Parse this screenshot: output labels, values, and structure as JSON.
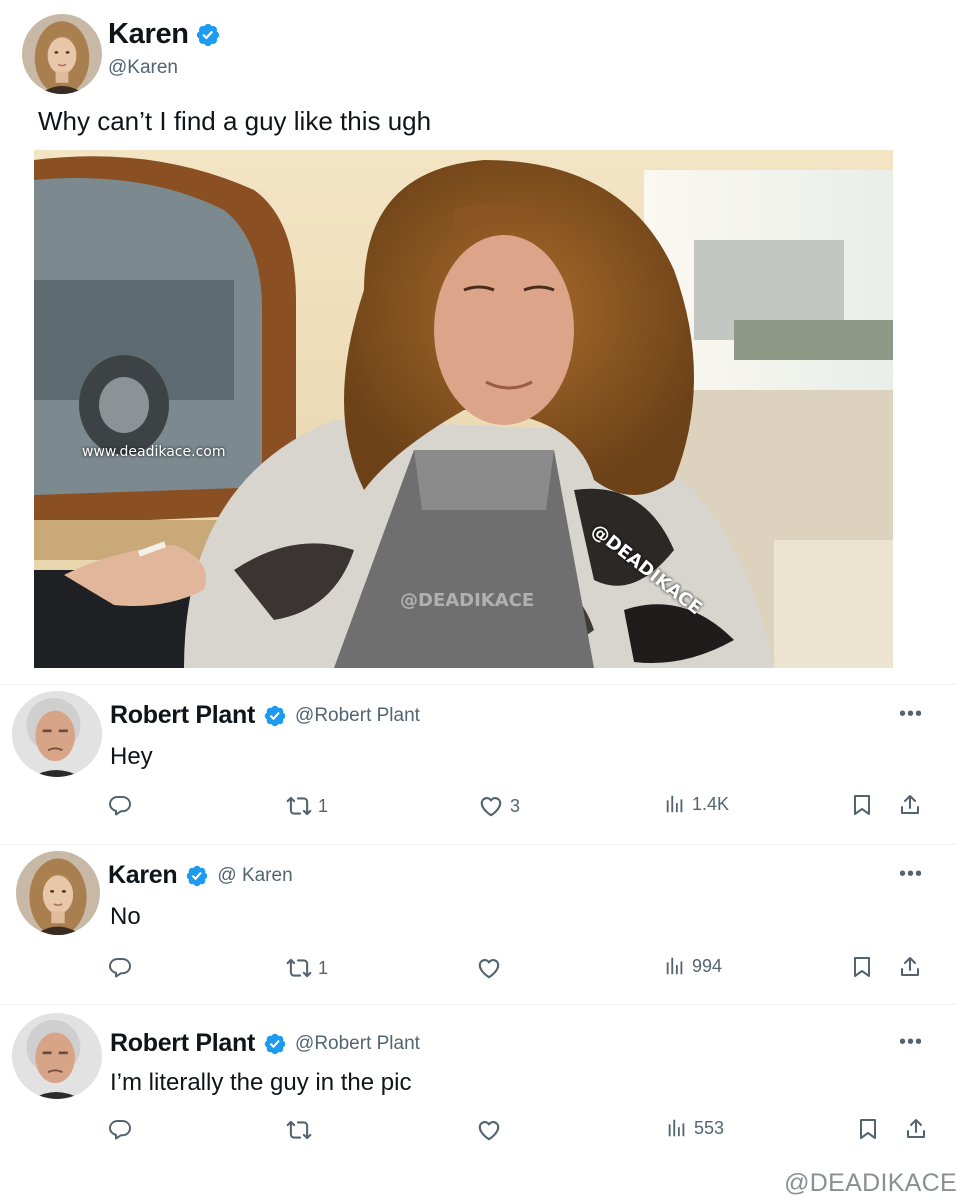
{
  "post": {
    "author_name": "Karen",
    "author_handle": "@Karen",
    "verified": true,
    "text": "Why can’t I find a guy like this ugh",
    "photo_watermarks": {
      "site": "www.deadikace.com",
      "handle": "@DEADIKACE",
      "faint": "@DEADIKACE"
    }
  },
  "replies": [
    {
      "author_name": "Robert Plant",
      "author_handle": "@Robert Plant",
      "verified": true,
      "text": "Hey",
      "more": "•••",
      "reposts": "1",
      "likes": "3",
      "views": "1.4K"
    },
    {
      "author_name": "Karen",
      "author_handle": "@ Karen",
      "verified": true,
      "text": "No",
      "more": "•••",
      "reposts": "1",
      "likes": "",
      "views": "994"
    },
    {
      "author_name": "Robert Plant",
      "author_handle": "@Robert Plant",
      "verified": true,
      "text": "I’m literally the guy in the pic",
      "more": "•••",
      "reposts": "",
      "likes": "",
      "views": "553"
    }
  ],
  "footer_watermark": "@DEADIKACE",
  "colors": {
    "verified": "#1d9bf0",
    "muted": "#536471",
    "text": "#0f1419"
  },
  "icons": [
    "verified-badge-icon",
    "reply-icon",
    "repost-icon",
    "like-icon",
    "views-icon",
    "bookmark-icon",
    "share-icon",
    "more-icon"
  ]
}
